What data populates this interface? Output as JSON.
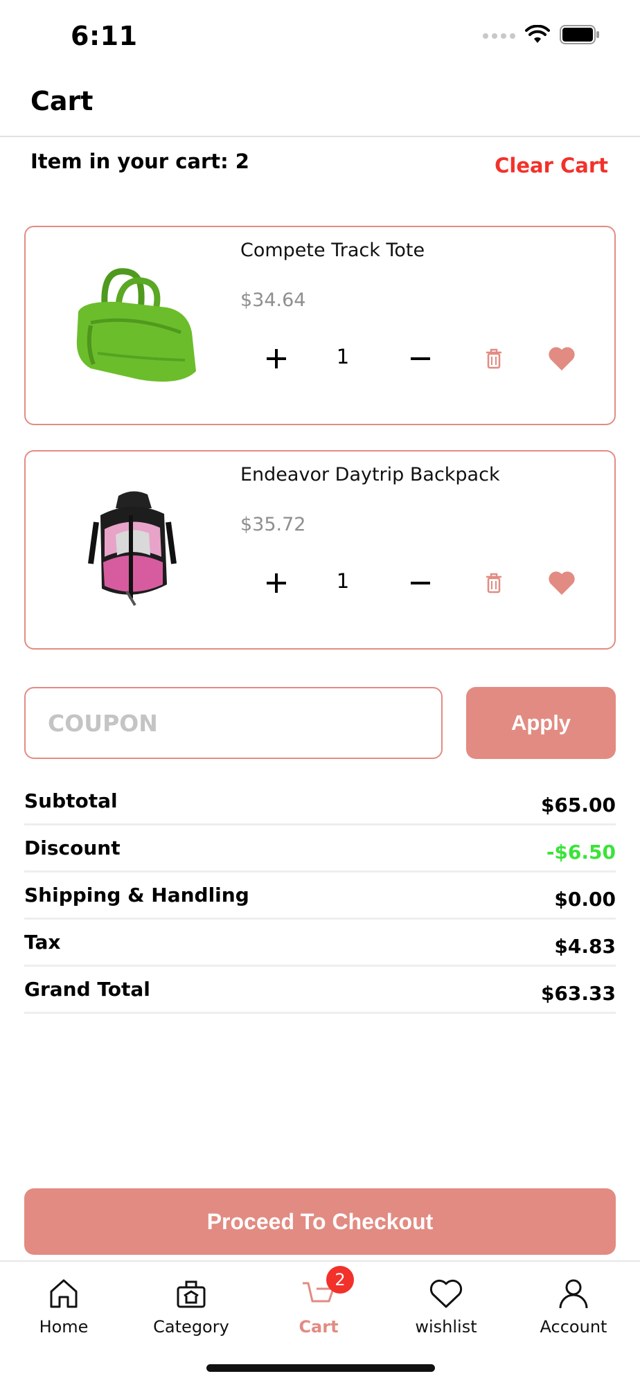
{
  "status_bar": {
    "time": "6:11"
  },
  "header": {
    "title": "Cart"
  },
  "cart_info": {
    "count_label": "Item in your cart: 2",
    "clear_label": "Clear Cart"
  },
  "items": [
    {
      "name": "Compete Track Tote",
      "price": "$34.64",
      "quantity": "1",
      "image": "green-tote-bag"
    },
    {
      "name": "Endeavor Daytrip Backpack",
      "price": "$35.72",
      "quantity": "1",
      "image": "pink-black-backpack"
    }
  ],
  "coupon": {
    "placeholder": "COUPON",
    "value": "",
    "apply_label": "Apply"
  },
  "summary": [
    {
      "label": "Subtotal",
      "value": "$65.00"
    },
    {
      "label": "Discount",
      "value": "-$6.50"
    },
    {
      "label": "Shipping & Handling",
      "value": "$0.00"
    },
    {
      "label": "Tax",
      "value": "$4.83"
    },
    {
      "label": "Grand Total",
      "value": "$63.33"
    }
  ],
  "checkout": {
    "label": "Proceed To Checkout"
  },
  "tab_bar": {
    "tabs": [
      {
        "label": "Home",
        "icon": "home-icon"
      },
      {
        "label": "Category",
        "icon": "category-icon"
      },
      {
        "label": "Cart",
        "icon": "cart-icon",
        "badge": "2",
        "active": true
      },
      {
        "label": "wishlist",
        "icon": "heart-icon"
      },
      {
        "label": "Account",
        "icon": "user-icon"
      }
    ]
  },
  "colors": {
    "accent": "#e28b82",
    "clear_cart": "#f2312a",
    "discount": "#3ae339",
    "price_gray": "#8e8e8e"
  }
}
